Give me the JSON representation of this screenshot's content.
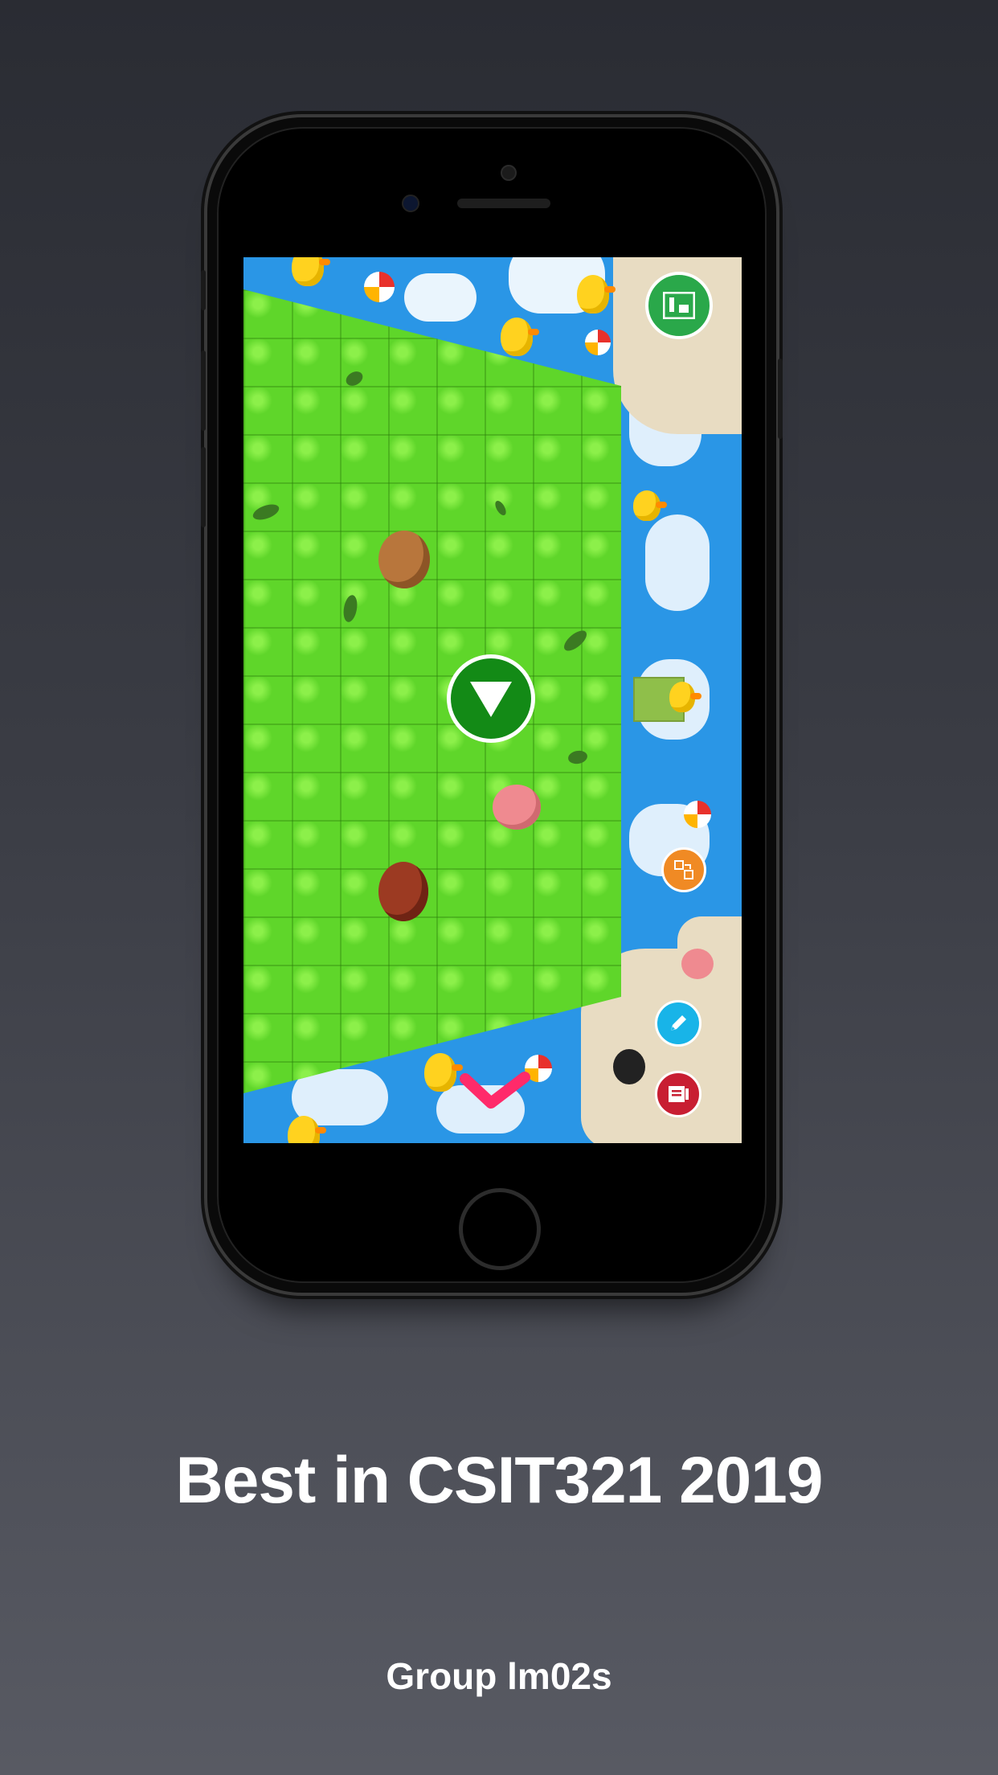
{
  "headline": "Best in CSIT321 2019",
  "subtitle": "Group lm02s",
  "game": {
    "play_button_icon": "down-triangle-icon",
    "map_button_icon": "map-icon",
    "puzzle_button_icon": "puzzle-icon",
    "pencil_button_icon": "pencil-icon",
    "list_button_icon": "list-icon",
    "collapse_icon": "chevron-down-icon"
  },
  "colors": {
    "water": "#2a96e6",
    "grass": "#5fd62a",
    "play_button": "#138a16",
    "map_button": "#2aa84a",
    "puzzle_button": "#f08a24",
    "pencil_button": "#18b4e8",
    "list_button": "#c81e32",
    "chevron": "#ff2a6a"
  }
}
